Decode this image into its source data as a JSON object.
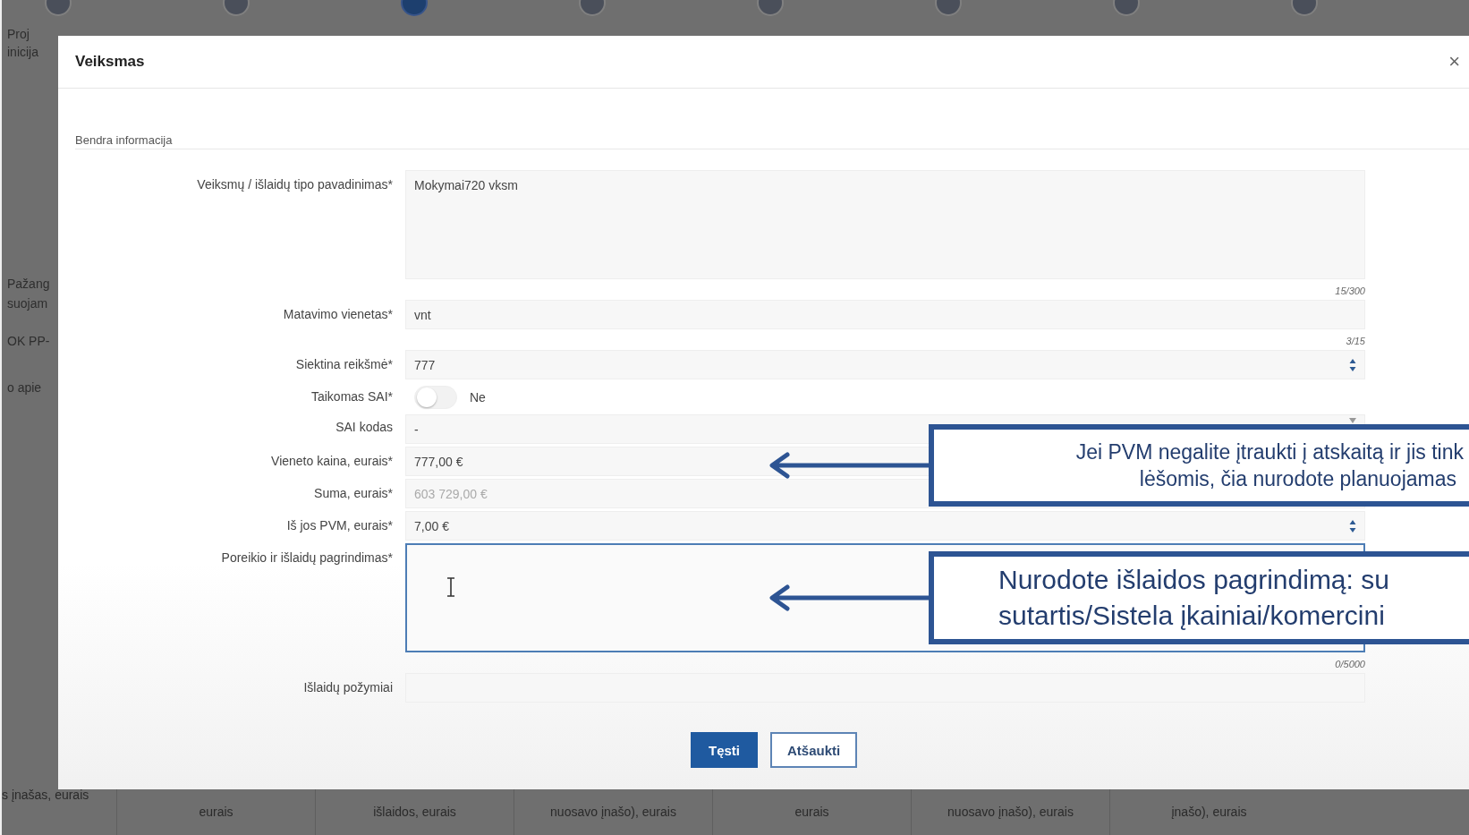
{
  "background": {
    "steps": [
      {
        "selected": false
      },
      {
        "selected": false
      },
      {
        "selected": true
      },
      {
        "selected": false
      },
      {
        "selected": false
      },
      {
        "selected": false
      },
      {
        "selected": false
      },
      {
        "selected": false
      }
    ],
    "side_fragments": [
      [
        "Proj",
        "inicija"
      ],
      [
        "Pažang",
        "suojam"
      ],
      [
        "OK PP-"
      ],
      [
        "o apie"
      ]
    ],
    "table_headers": [
      "s įnašas, eurais",
      "eurais",
      "išlaidos, eurais",
      "nuosavo įnašo), eurais",
      "eurais",
      "nuosavo įnašo), eurais",
      "įnašo), eurais"
    ]
  },
  "modal": {
    "title": "Veiksmas",
    "close": "×",
    "section": "Bendra informacija",
    "fields": [
      {
        "kind": "textarea",
        "label": "Veiksmų / išlaidų tipo pavadinimas*",
        "value": "Mokymai720 vksm",
        "counter": "15/300",
        "focused": false
      },
      {
        "kind": "text",
        "label": "Matavimo vienetas*",
        "value": "vnt",
        "counter": "3/15"
      },
      {
        "kind": "number",
        "label": "Siektina reikšmė*",
        "value": "777",
        "disabled": false,
        "spinner": true
      },
      {
        "kind": "toggle",
        "label": "Taikomas SAI*",
        "on": false,
        "text": "Ne"
      },
      {
        "kind": "select",
        "label": "SAI kodas",
        "value": "-"
      },
      {
        "kind": "number",
        "label": "Vieneto kaina, eurais*",
        "value": "777,00 €",
        "disabled": false
      },
      {
        "kind": "number",
        "label": "Suma, eurais*",
        "value": "603 729,00 €",
        "disabled": true,
        "spinner": false
      },
      {
        "kind": "number",
        "label": "Iš jos PVM, eurais*",
        "value": "7,00 €",
        "disabled": false,
        "spinner": true
      },
      {
        "kind": "textarea",
        "label": "Poreikio ir išlaidų pagrindimas*",
        "counter": "0/5000",
        "focused": true
      },
      {
        "kind": "text",
        "label": "Išlaidų požymiai"
      }
    ],
    "buttons": [
      {
        "label": "Tęsti",
        "primary": true
      },
      {
        "label": "Atšaukti",
        "primary": false
      }
    ]
  },
  "callouts": [
    {
      "lines": [
        "Jei PVM negalite įtraukti į atskaitą ir jis tink",
        "lėšomis, čia nurodote planuojamas"
      ]
    },
    {
      "lines": [
        "Nurodote išlaidos pagrindimą: su",
        "sutartis/Sistela įkainiai/komercini"
      ]
    }
  ]
}
